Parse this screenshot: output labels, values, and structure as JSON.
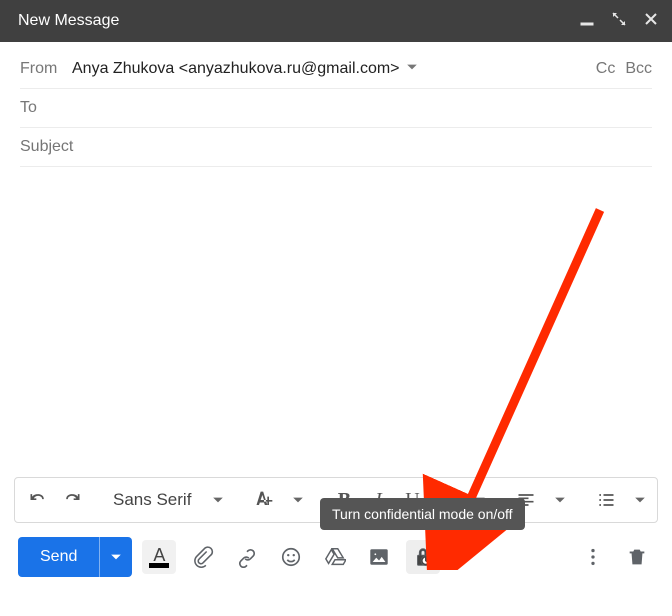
{
  "titlebar": {
    "title": "New Message"
  },
  "from": {
    "label": "From",
    "address": "Anya Zhukova <anyazhukova.ru@gmail.com>",
    "cc": "Cc",
    "bcc": "Bcc"
  },
  "to": {
    "label": "To",
    "value": ""
  },
  "subject": {
    "placeholder": "Subject",
    "value": ""
  },
  "format": {
    "font": "Sans Serif",
    "bold": "B",
    "italic": "I",
    "underline": "U"
  },
  "send": {
    "label": "Send"
  },
  "tooltip": "Turn confidential mode on/off"
}
